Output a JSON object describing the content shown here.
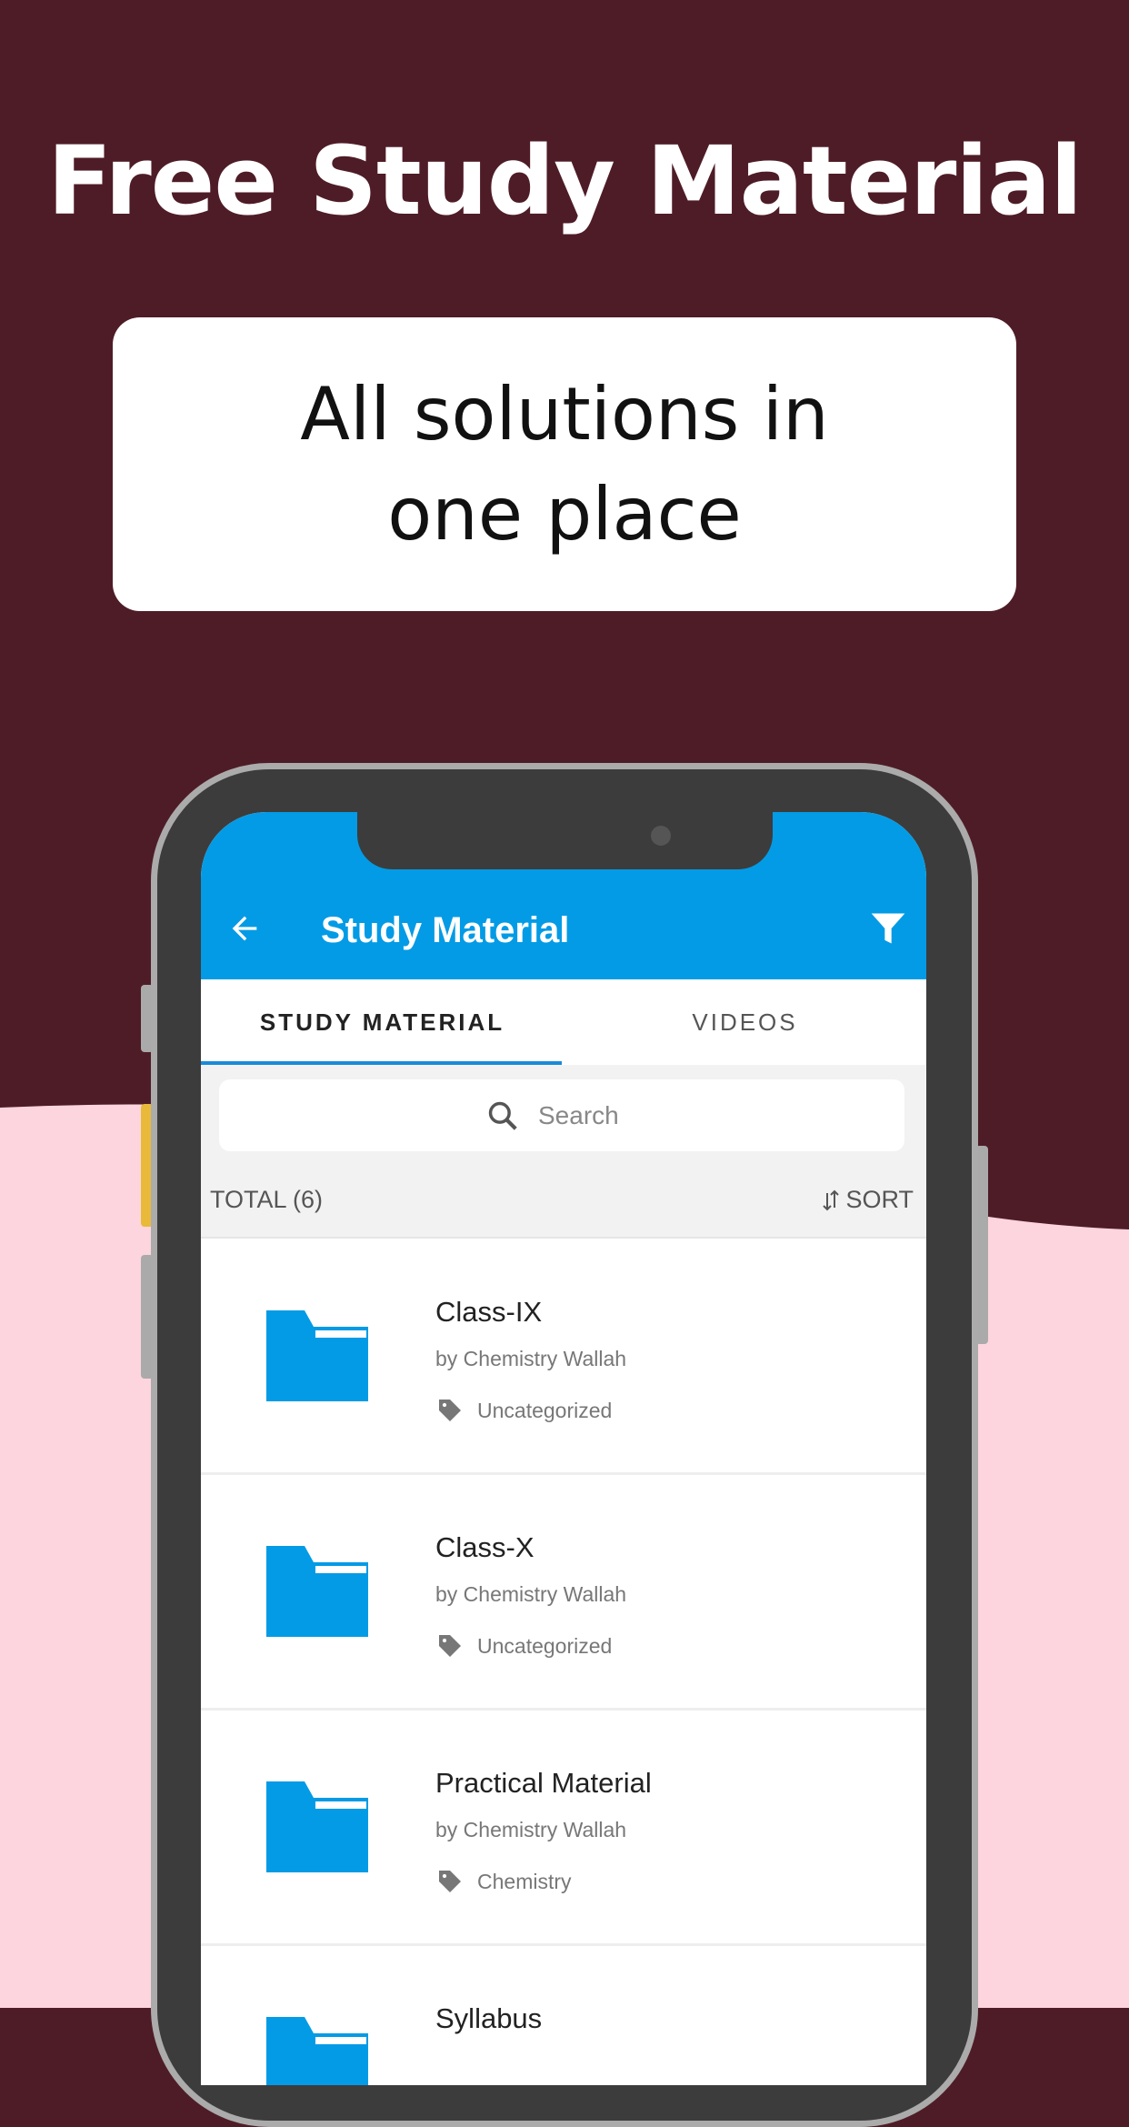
{
  "promo": {
    "headline": "Free Study Material",
    "subheadline": "All solutions in one place"
  },
  "colors": {
    "maroon": "#4e1c27",
    "pink": "#fdd5de",
    "app_blue": "#039be5",
    "folder_blue": "#039be5"
  },
  "app": {
    "title": "Study Material",
    "back_icon": "arrow-left-icon",
    "filter_icon": "filter-icon",
    "tabs": [
      {
        "label": "STUDY MATERIAL",
        "active": true
      },
      {
        "label": "VIDEOS",
        "active": false
      }
    ],
    "search": {
      "placeholder": "Search"
    },
    "total_label": "TOTAL (6)",
    "sort_label": "SORT",
    "items": [
      {
        "title": "Class-IX",
        "author": "by Chemistry Wallah",
        "tag": "Uncategorized"
      },
      {
        "title": "Class-X",
        "author": "by Chemistry Wallah",
        "tag": "Uncategorized"
      },
      {
        "title": "Practical Material",
        "author": "by Chemistry Wallah",
        "tag": "Chemistry"
      },
      {
        "title": "Syllabus"
      }
    ]
  }
}
